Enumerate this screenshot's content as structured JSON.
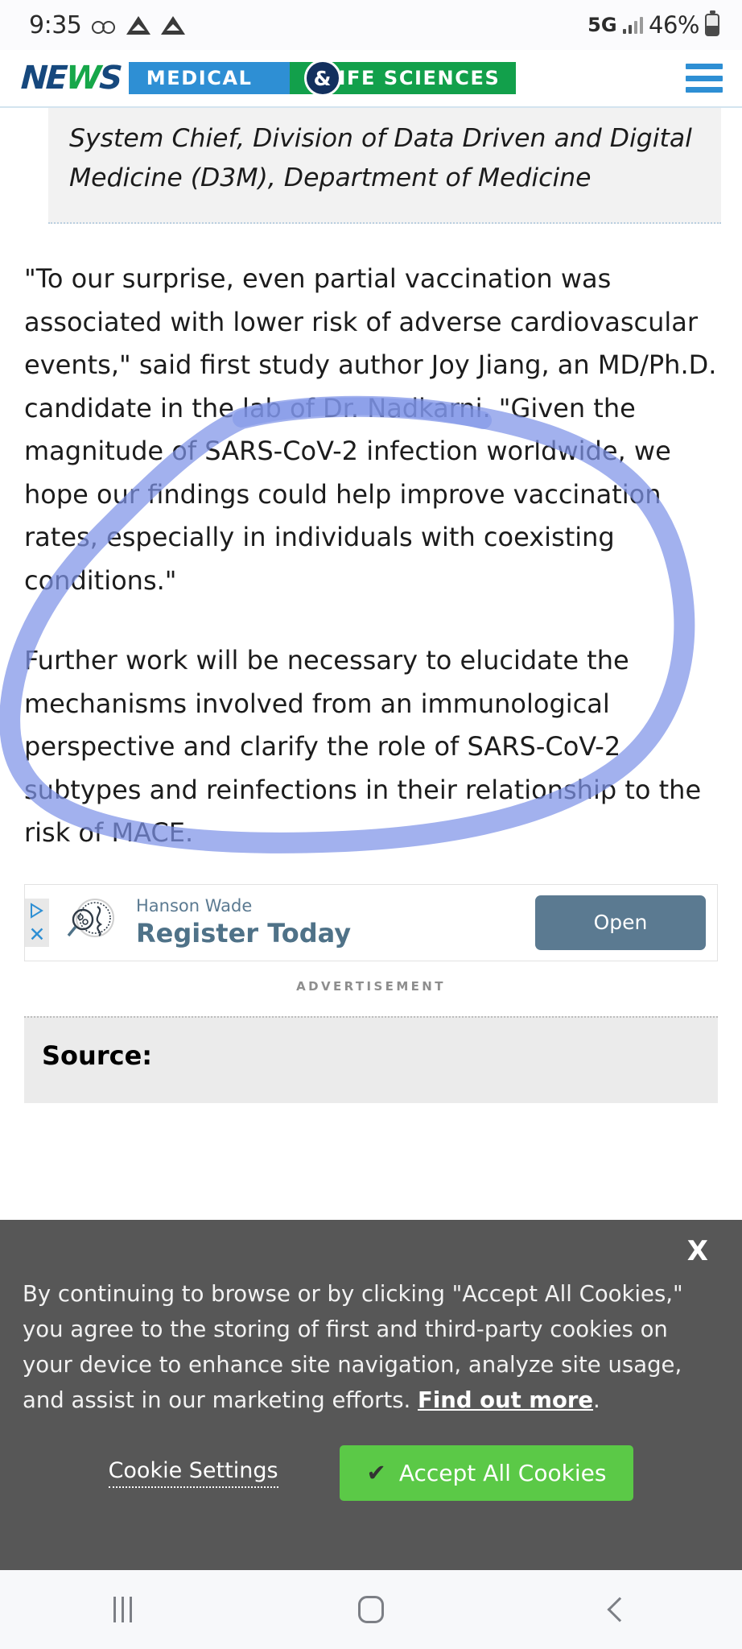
{
  "status_bar": {
    "time": "9:35",
    "voicemail_icon": "voicemail-icon",
    "triangle_icon_1": "delta-triangle-icon",
    "triangle_icon_2": "delta-triangle-icon",
    "network": "5G",
    "signal_icon": "signal-bars-icon",
    "battery_percent": "46%",
    "battery_icon": "battery-icon"
  },
  "site_header": {
    "logo_news": "NEWS",
    "logo_news_accent": "W",
    "logo_medical": "MEDICAL",
    "logo_ampersand": "&",
    "logo_life_sciences": "LIFE SCIENCES",
    "menu_icon": "hamburger-menu-icon",
    "brand_blue": "#2e8fd4",
    "brand_green": "#12a04b",
    "brand_navy": "#16487d"
  },
  "article": {
    "quote_attribution": "System Chief, Division of Data Driven and Digital Medicine (D3M), Department of Medicine",
    "paragraph_1": "\"To our surprise, even partial vaccination was associated with lower risk of adverse cardiovascular events,\" said first study author Joy Jiang, an MD/Ph.D. candidate in the lab of Dr. Nadkarni. \"Given the magnitude of SARS-CoV-2 infection worldwide, we hope our findings could help improve vaccination rates, especially in individuals with coexisting conditions.\"",
    "paragraph_2": "Further work will be necessary to elucidate the mechanisms involved from an immunological perspective and clarify the role of SARS-CoV-2 subtypes and reinfections in their relationship to the risk of MACE.",
    "source_heading": "Source:",
    "annotation_color": "#7e93e8"
  },
  "advertisement": {
    "adchoices_icon": "adchoices-triangle-icon",
    "close_icon": "close-x-icon",
    "logo_icon": "magnifier-dna-circle-icon",
    "brand": "Hanson Wade",
    "headline": "Register Today",
    "cta_label": "Open",
    "cta_color": "#5b7a91",
    "label": "ADVERTISEMENT"
  },
  "cookie_banner": {
    "close_label": "X",
    "text_before_link": "By continuing to browse or by clicking \"Accept All Cookies,\" you agree to the storing of first and third-party cookies on your device to enhance site navigation, analyze site usage, and assist in our marketing efforts. ",
    "link_label": "Find out more",
    "text_after_link": ".",
    "settings_label": "Cookie Settings",
    "accept_label": "Accept All Cookies",
    "accept_check_icon": "checkmark-icon",
    "accept_color": "#5bc947",
    "background_color": "#575757"
  },
  "nav_bar": {
    "recents_icon": "recents-icon",
    "home_icon": "home-icon",
    "back_icon": "back-chevron-icon"
  }
}
